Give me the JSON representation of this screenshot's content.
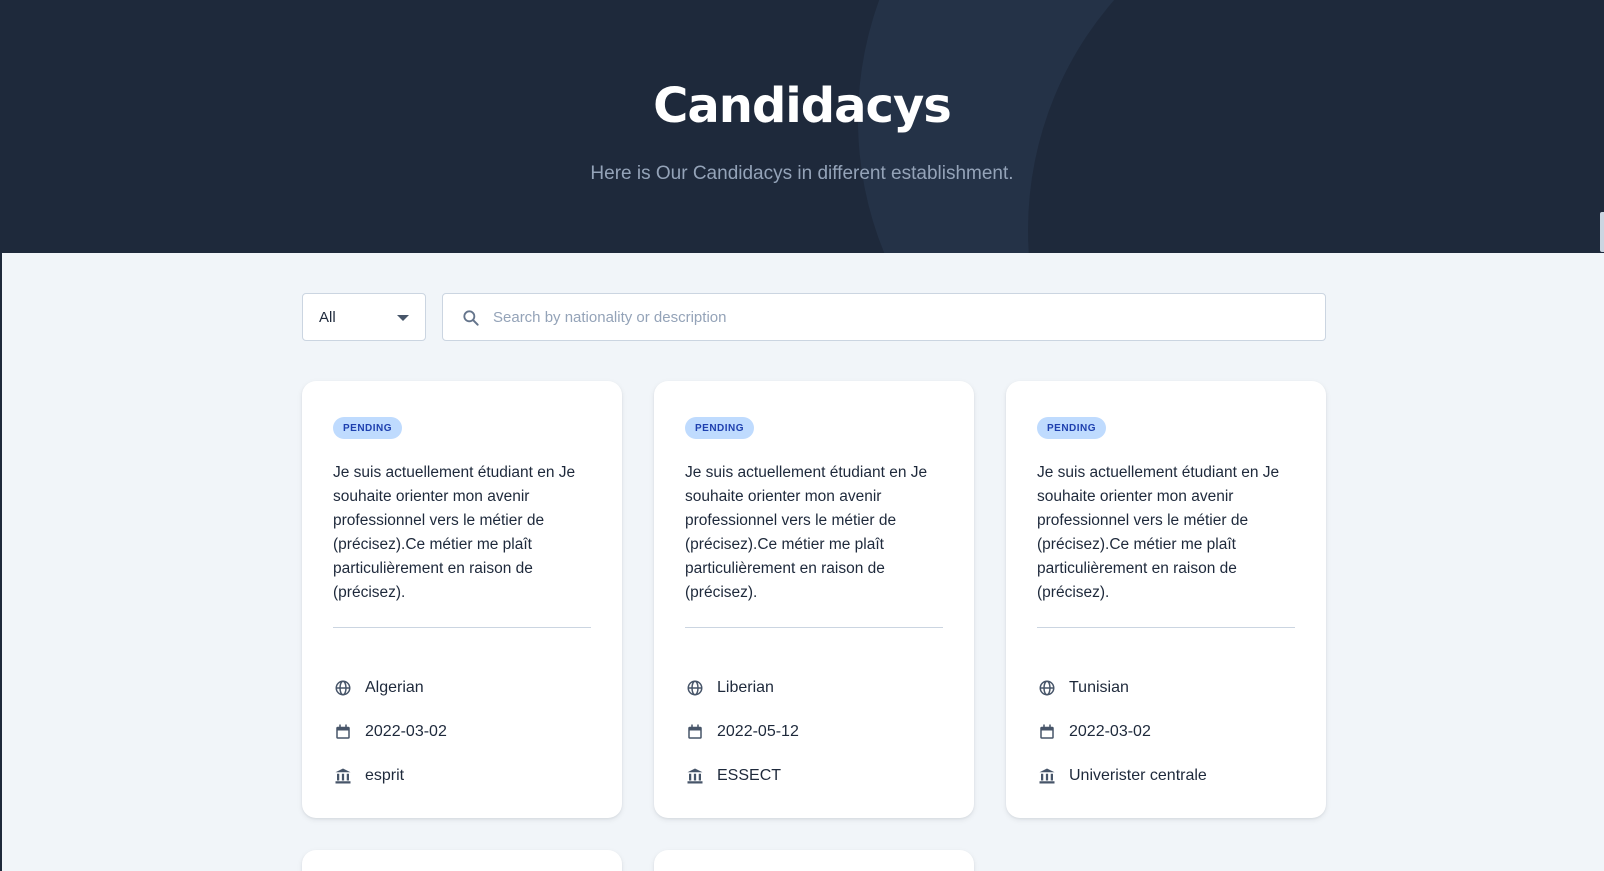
{
  "header": {
    "title": "Candidacys",
    "subtitle": "Here is Our Candidacys in different establishment."
  },
  "filters": {
    "status_selected": "All",
    "search_placeholder": "Search by nationality or description"
  },
  "colors": {
    "hero_bg": "#1e293b",
    "page_bg": "#f1f5f9",
    "badge_bg": "#bfdbfe",
    "badge_text": "#1e40af"
  },
  "cards": [
    {
      "status": "PENDING",
      "description": "Je suis actuellement étudiant en Je souhaite orienter mon avenir professionnel vers le métier de (précisez).Ce métier me plaît particulièrement en raison de (précisez).",
      "nationality": "Algerian",
      "date": "2022-03-02",
      "establishment": "esprit"
    },
    {
      "status": "PENDING",
      "description": "Je suis actuellement étudiant en Je souhaite orienter mon avenir professionnel vers le métier de (précisez).Ce métier me plaît particulièrement en raison de (précisez).",
      "nationality": "Liberian",
      "date": "2022-05-12",
      "establishment": "ESSECT"
    },
    {
      "status": "PENDING",
      "description": "Je suis actuellement étudiant en Je souhaite orienter mon avenir professionnel vers le métier de (précisez).Ce métier me plaît particulièrement en raison de (précisez).",
      "nationality": "Tunisian",
      "date": "2022-03-02",
      "establishment": "Univerister centrale"
    }
  ],
  "icons": {
    "nationality": "globe-icon",
    "date": "calendar-icon",
    "establishment": "institution-icon",
    "search": "search-icon"
  }
}
